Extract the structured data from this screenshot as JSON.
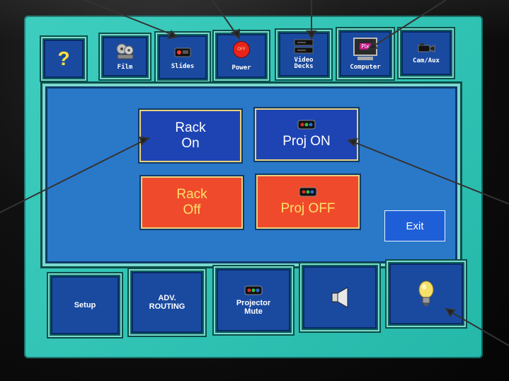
{
  "top_buttons": {
    "help": "?",
    "film": "Film",
    "slides": "Slides",
    "power": "Power",
    "power_badge": "OFF",
    "video_decks_line1": "Video",
    "video_decks_line2": "Decks",
    "computer": "Computer",
    "computer_screen": "Pix",
    "cam_aux": "Cam/Aux"
  },
  "main": {
    "rack_on_line1": "Rack",
    "rack_on_line2": "On",
    "proj_on": "Proj ON",
    "rack_off_line1": "Rack",
    "rack_off_line2": "Off",
    "proj_off": "Proj OFF",
    "exit": "Exit"
  },
  "bottom_buttons": {
    "setup": "Setup",
    "adv_routing_line1": "ADV.",
    "adv_routing_line2": "ROUTING",
    "projector_mute_line1": "Projector",
    "projector_mute_line2": "Mute"
  },
  "colors": {
    "screen_bg": "#28c8b8",
    "button_blue": "#1a4aa0",
    "on_blue": "#1e44b4",
    "off_red": "#f04a2c",
    "off_text_yellow": "#ffe06a",
    "power_red": "#e8241c"
  }
}
